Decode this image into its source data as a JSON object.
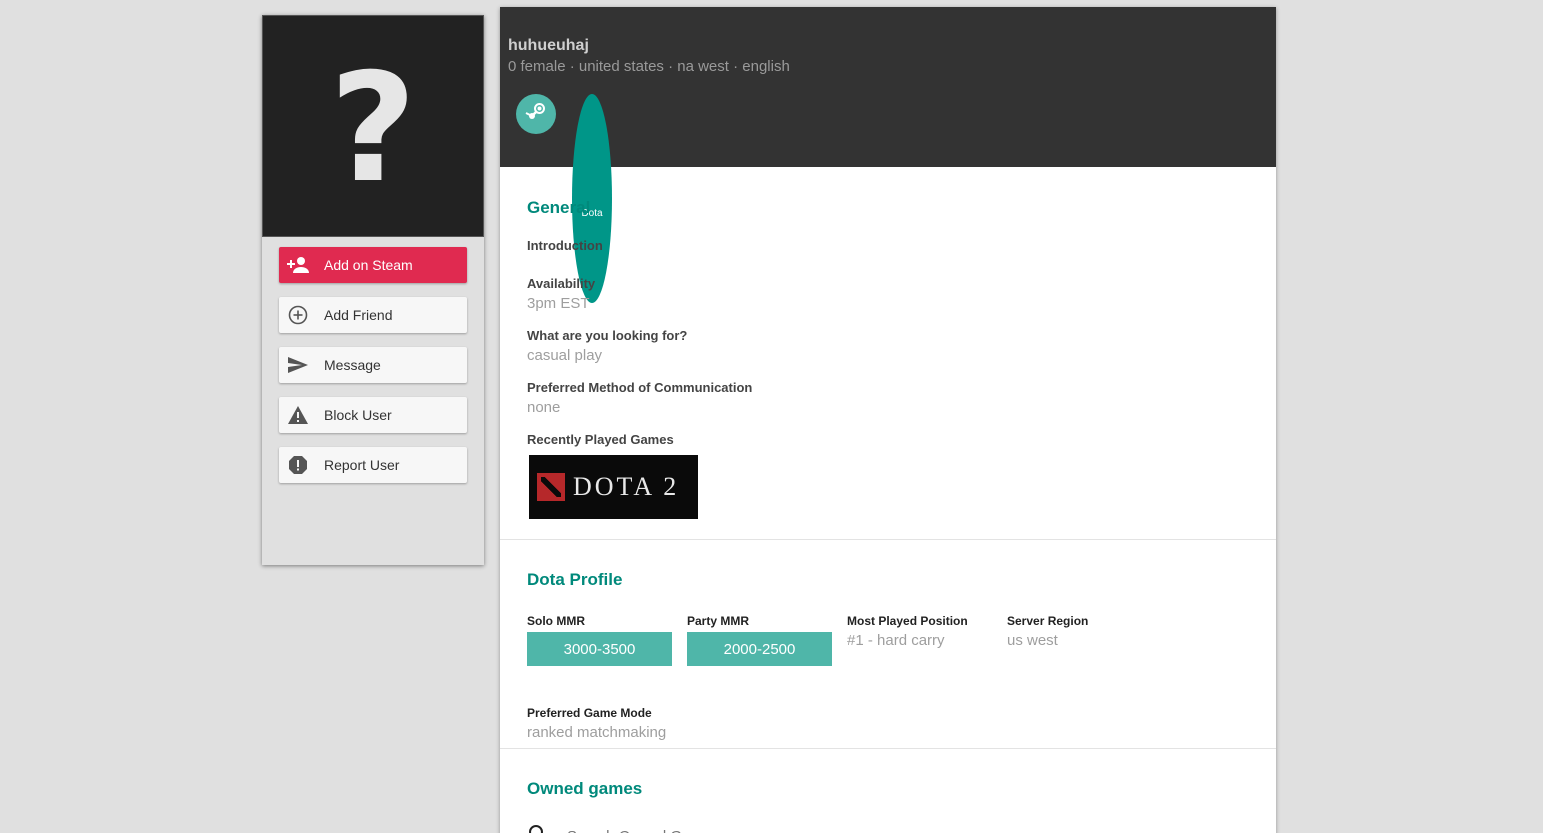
{
  "sidebar": {
    "avatar_glyph": "?",
    "actions": [
      {
        "label": "Add on Steam",
        "icon": "person-add-icon"
      },
      {
        "label": "Add Friend",
        "icon": "plus-circle-icon"
      },
      {
        "label": "Message",
        "icon": "send-icon"
      },
      {
        "label": "Block User",
        "icon": "warning-icon"
      },
      {
        "label": "Report User",
        "icon": "report-icon"
      }
    ]
  },
  "profile": {
    "username": "huhueuhaj",
    "meta": "0 female · united states · na west · english",
    "badges": [
      {
        "name": "steam",
        "icon": "steam-icon"
      },
      {
        "name": "dota",
        "label": "Dota"
      }
    ]
  },
  "general": {
    "title": "General",
    "introduction_label": "Introduction",
    "availability_label": "Availability",
    "availability_value": "3pm EST",
    "looking_for_label": "What are you looking for?",
    "looking_for_value": "casual play",
    "communication_label": "Preferred Method of Communication",
    "communication_value": "none",
    "recent_games_label": "Recently Played Games",
    "recent_games": [
      {
        "name": "DOTA 2"
      }
    ]
  },
  "dota_profile": {
    "title": "Dota Profile",
    "solo_mmr_label": "Solo MMR",
    "solo_mmr_value": "3000-3500",
    "party_mmr_label": "Party MMR",
    "party_mmr_value": "2000-2500",
    "position_label": "Most Played Position",
    "position_value": "#1 - hard carry",
    "region_label": "Server Region",
    "region_value": "us west",
    "game_mode_label": "Preferred Game Mode",
    "game_mode_value": "ranked matchmaking"
  },
  "owned_games": {
    "title": "Owned games",
    "search_placeholder": "Search Owned Games"
  },
  "colors": {
    "accent": "#009688",
    "primary_button": "#e02a50",
    "header_bg": "#333333"
  }
}
